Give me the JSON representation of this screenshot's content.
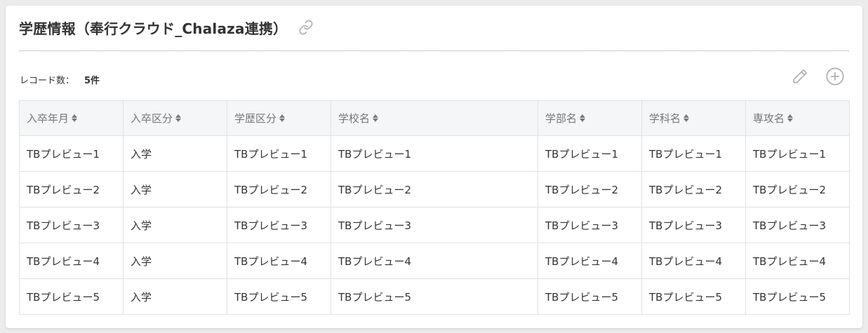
{
  "section": {
    "title": "学歴情報（奉行クラウド_Chalaza連携）",
    "link_icon": "link-icon"
  },
  "records": {
    "label": "レコード数：",
    "count": "5件"
  },
  "actions": {
    "edit_icon": "pencil-icon",
    "add_icon": "plus-circle-icon"
  },
  "table": {
    "columns": [
      "入卒年月",
      "入卒区分",
      "学歴区分",
      "学校名",
      "学部名",
      "学科名",
      "専攻名"
    ],
    "rows": [
      [
        "TBプレビュー1",
        "入学",
        "TBプレビュー1",
        "TBプレビュー1",
        "TBプレビュー1",
        "TBプレビュー1",
        "TBプレビュー1"
      ],
      [
        "TBプレビュー2",
        "入学",
        "TBプレビュー2",
        "TBプレビュー2",
        "TBプレビュー2",
        "TBプレビュー2",
        "TBプレビュー2"
      ],
      [
        "TBプレビュー3",
        "入学",
        "TBプレビュー3",
        "TBプレビュー3",
        "TBプレビュー3",
        "TBプレビュー3",
        "TBプレビュー3"
      ],
      [
        "TBプレビュー4",
        "入学",
        "TBプレビュー4",
        "TBプレビュー4",
        "TBプレビュー4",
        "TBプレビュー4",
        "TBプレビュー4"
      ],
      [
        "TBプレビュー5",
        "入学",
        "TBプレビュー5",
        "TBプレビュー5",
        "TBプレビュー5",
        "TBプレビュー5",
        "TBプレビュー5"
      ]
    ]
  }
}
